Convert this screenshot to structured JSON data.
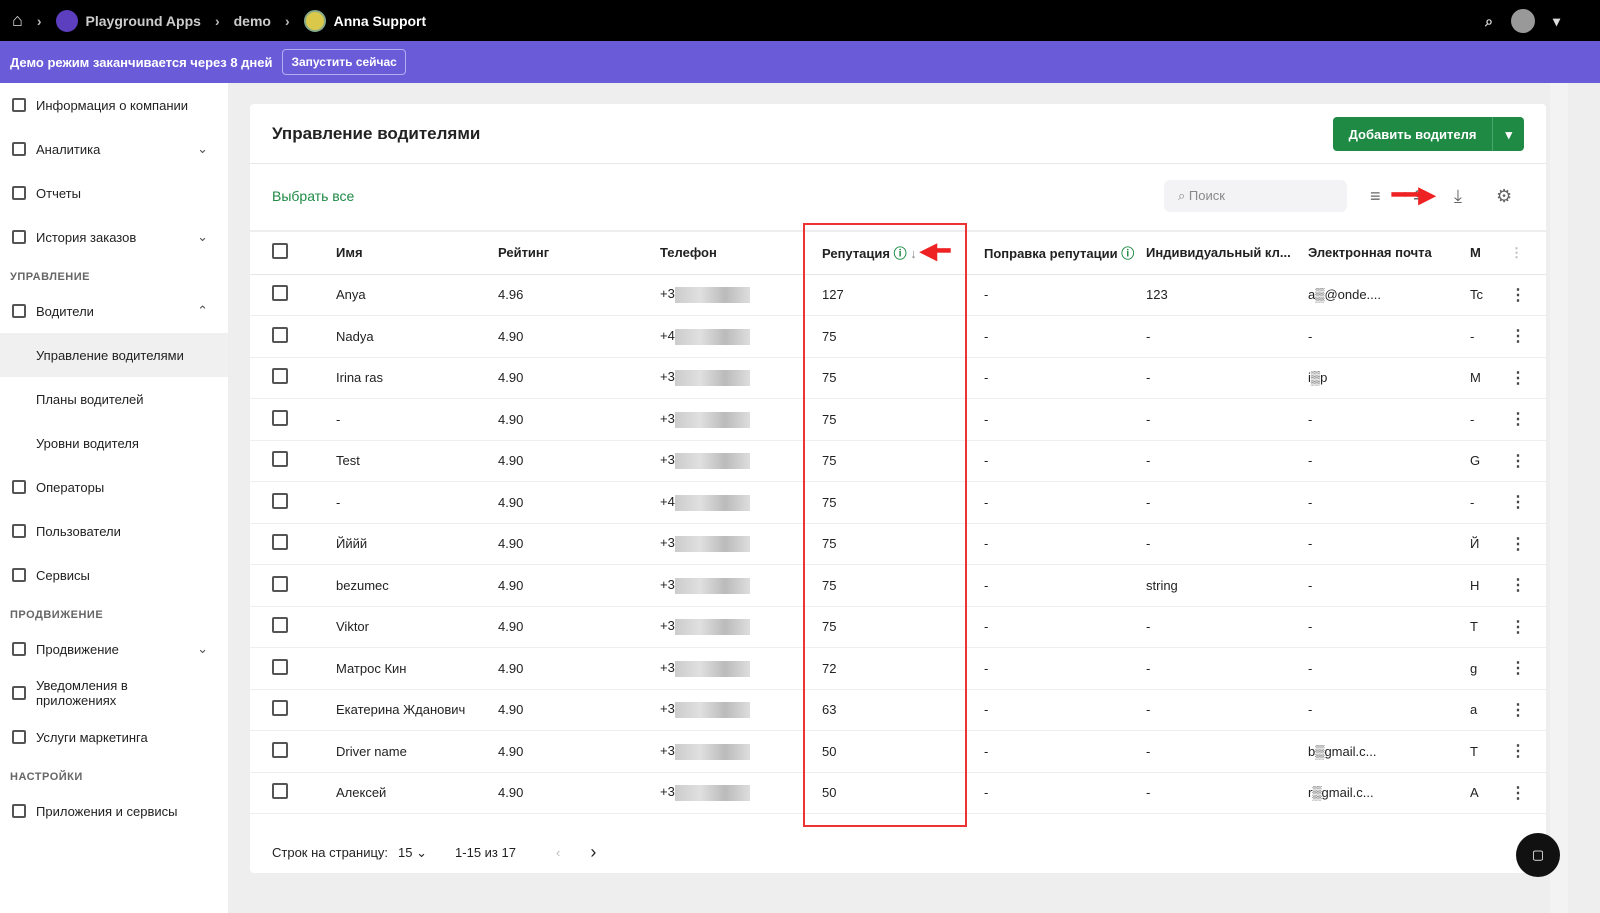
{
  "topbar": {
    "crumbs": [
      "Playground Apps",
      "demo",
      "Anna Support"
    ]
  },
  "banner": {
    "text": "Демо режим заканчивается через 8 дней",
    "button": "Запустить сейчас"
  },
  "sidebar": {
    "items": [
      "Информация о компании",
      "Аналитика",
      "Отчеты",
      "История заказов"
    ],
    "sec1": "УПРАВЛЕНИЕ",
    "mgmt": [
      "Водители",
      "Управление водителями",
      "Планы водителей",
      "Уровни водителя",
      "Операторы",
      "Пользователи",
      "Сервисы"
    ],
    "sec2": "ПРОДВИЖЕНИЕ",
    "promo": [
      "Продвижение",
      "Уведомления в приложениях",
      "Услуги маркетинга"
    ],
    "sec3": "НАСТРОЙКИ",
    "settings": [
      "Приложения и сервисы"
    ]
  },
  "main": {
    "title": "Управление водителями",
    "add": "Добавить водителя",
    "select_all": "Выбрать все",
    "search_placeholder": "Поиск",
    "columns": [
      "Имя",
      "Рейтинг",
      "Телефон",
      "Репутация",
      "Поправка репутации",
      "Индивидуальный кл...",
      "Электронная почта",
      "М"
    ],
    "rows": [
      [
        "Anya",
        "4.96",
        "+3",
        "127",
        "-",
        "123",
        "a▒@onde....",
        "Tc"
      ],
      [
        "Nadya",
        "4.90",
        "+4",
        "75",
        "-",
        "-",
        "-",
        "-"
      ],
      [
        "Irina ras",
        "4.90",
        "+3",
        "75",
        "-",
        "-",
        "i▒p",
        "M"
      ],
      [
        "-",
        "4.90",
        "+3",
        "75",
        "-",
        "-",
        "-",
        "-"
      ],
      [
        "Test",
        "4.90",
        "+3",
        "75",
        "-",
        "-",
        "-",
        "G"
      ],
      [
        "-",
        "4.90",
        "+4",
        "75",
        "-",
        "-",
        "-",
        "-"
      ],
      [
        "Йййй",
        "4.90",
        "+3",
        "75",
        "-",
        "-",
        "-",
        "Й"
      ],
      [
        "bezumec",
        "4.90",
        "+3",
        "75",
        "-",
        "string",
        "-",
        "H"
      ],
      [
        "Viktor",
        "4.90",
        "+3",
        "75",
        "-",
        "-",
        "-",
        "T"
      ],
      [
        "Матрос Кин",
        "4.90",
        "+3",
        "72",
        "-",
        "-",
        "-",
        "g"
      ],
      [
        "Екатерина Жданович",
        "4.90",
        "+3",
        "63",
        "-",
        "-",
        "-",
        "a"
      ],
      [
        "Driver name",
        "4.90",
        "+3",
        "50",
        "-",
        "-",
        "b▒gmail.c...",
        "T"
      ],
      [
        "Алексей",
        "4.90",
        "+3",
        "50",
        "-",
        "-",
        "r▒gmail.c...",
        "A"
      ]
    ],
    "footer": {
      "rows_label": "Строк на страницу:",
      "rows_value": "15",
      "range": "1-15 из 17"
    }
  }
}
